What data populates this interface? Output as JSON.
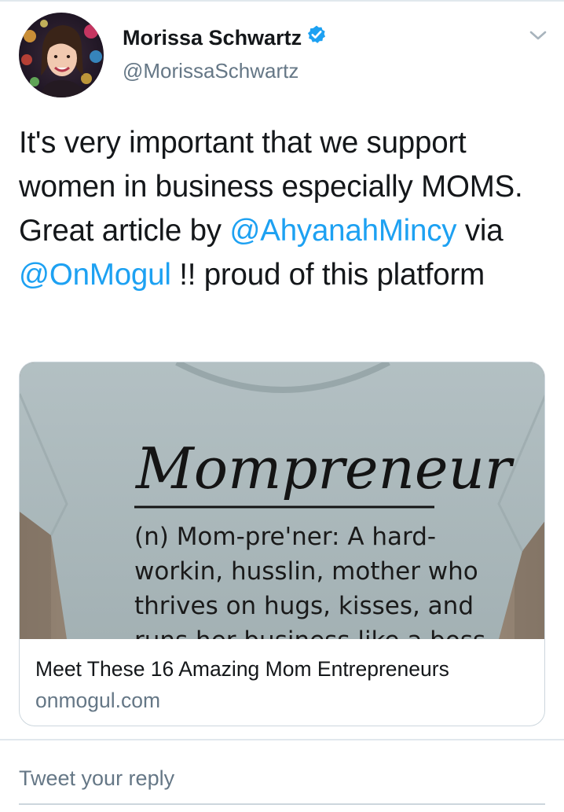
{
  "tweet": {
    "author": {
      "name": "Morissa Schwartz",
      "handle": "@MorissaSchwartz",
      "verified": true
    },
    "text_parts": [
      "It's very important that we support women in business especially MOMS. Great article by ",
      "@AhyanahMincy",
      " via ",
      "@OnMogul",
      " !! proud of this platform"
    ],
    "mentions": [
      "@AhyanahMincy",
      "@OnMogul"
    ]
  },
  "card": {
    "image": {
      "headline": "Mompreneur",
      "lines": [
        "(n) Mom-pre'ner: A hard-",
        "workin, husslin, mother who",
        "thrives on hugs, kisses, and",
        "runs her business like a boss"
      ]
    },
    "title": "Meet These 16 Amazing Mom Entrepreneurs",
    "domain": "onmogul.com"
  },
  "reply": {
    "placeholder": "Tweet your reply"
  },
  "colors": {
    "link": "#1da1f2",
    "secondary_text": "#657786",
    "verified_badge": "#1da1f2",
    "border": "#ccd6dd"
  },
  "icons": {
    "verified": "verified-badge-icon",
    "menu": "chevron-down-icon"
  }
}
